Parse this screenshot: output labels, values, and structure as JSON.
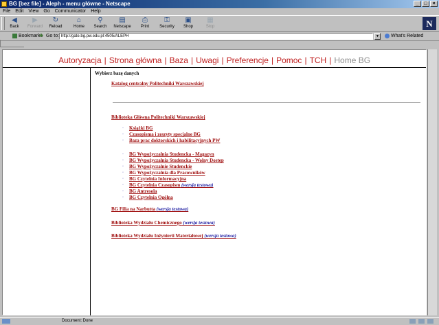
{
  "window": {
    "title": "BG [bez file] - Aleph - menu główne - Netscape",
    "controls": [
      "_",
      "□",
      "×"
    ]
  },
  "menubar": [
    "File",
    "Edit",
    "View",
    "Go",
    "Communicator",
    "Help"
  ],
  "toolbar": {
    "buttons": [
      {
        "label": "Back",
        "icon": "back-arrow-icon"
      },
      {
        "label": "Forward",
        "icon": "forward-arrow-icon"
      },
      {
        "label": "Reload",
        "icon": "reload-icon"
      },
      {
        "label": "Home",
        "icon": "home-icon"
      },
      {
        "label": "Search",
        "icon": "search-icon"
      },
      {
        "label": "Netscape",
        "icon": "netscape-icon"
      },
      {
        "label": "Print",
        "icon": "print-icon"
      },
      {
        "label": "Security",
        "icon": "lock-icon"
      },
      {
        "label": "Shop",
        "icon": "shop-icon"
      },
      {
        "label": "Stop",
        "icon": "stop-icon"
      }
    ],
    "logo": "N"
  },
  "location": {
    "bookmarks_label": "Bookmarks",
    "goto_label": "Go to:",
    "url": "http://gate.bg.pw.edu.pl:4505/ALEPH",
    "whats_related": "What's Related"
  },
  "nav": {
    "items": [
      "Autoryzacja",
      "Strona główna",
      "Baza",
      "Uwagi",
      "Preferencje",
      "Pomoc",
      "TCH",
      "Home BG"
    ],
    "separator": "|",
    "current_index": 7
  },
  "main": {
    "heading": "Wybierz bazę danych",
    "catalog_link": "Katalog centralny Politechniki Warszawskiej",
    "library_heading": "Biblioteka Główna Politechniki Warszawskiej",
    "group1": [
      "Książki BG",
      "Czasopisma i zeszyty specjalne BG",
      "Baza prac doktorskich i habilitacyjnych PW"
    ],
    "group2": [
      {
        "label": "BG Wypożyczalnia Studencka - Magazyn",
        "suffix": ""
      },
      {
        "label": "BG Wypożyczalnia Studencka - Wolny Dostęp",
        "suffix": ""
      },
      {
        "label": "BG Wypożyczalnie Studenckie",
        "suffix": ""
      },
      {
        "label": "BG Wypożyczalnia dla Pracowników",
        "suffix": ""
      },
      {
        "label": "BG Czytelnia Informacyjna",
        "suffix": ""
      },
      {
        "label": "BG Czytelnia Czasopism",
        "suffix": "(wersja testowa)"
      },
      {
        "label": "BG Antresola",
        "suffix": ""
      },
      {
        "label": "BG Czytelnia Ogólna",
        "suffix": ""
      }
    ],
    "other_libraries": [
      {
        "label": "BG Filia na Narbutta",
        "suffix": "(wersja testowa)"
      },
      {
        "label": "Biblioteka Wydziału Chemicznego",
        "suffix": "(wersja testowa)"
      },
      {
        "label": "Biblioteka Wydziału Inżynierii Materiałowej",
        "suffix": "(wersja testowa)"
      }
    ]
  },
  "statusbar": {
    "text": "Document: Done"
  },
  "colors": {
    "link": "#a01010",
    "nav": "#c02020",
    "nav_current": "#8f8f8f",
    "test_version": "#1a1aa0"
  }
}
